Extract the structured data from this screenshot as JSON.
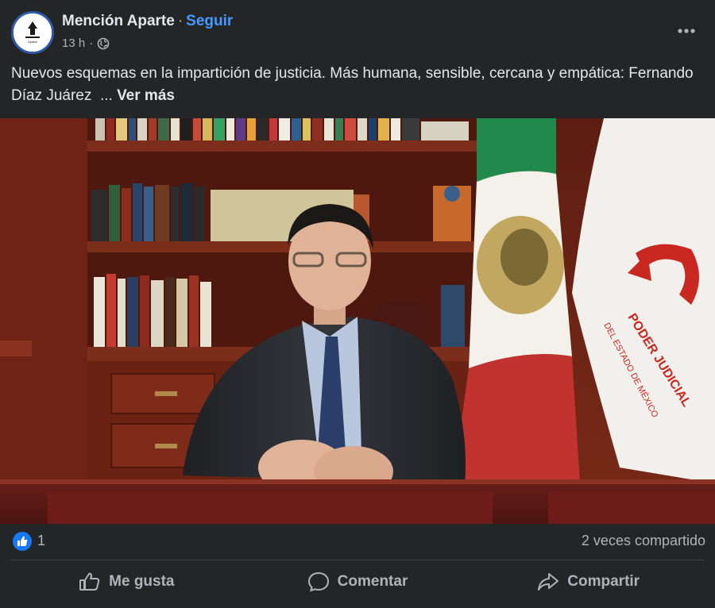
{
  "post": {
    "author": "Mención Aparte",
    "separator": "·",
    "follow_label": "Seguir",
    "time": "13 h",
    "meta_separator": "·",
    "privacy_icon": "globe-icon",
    "avatar_caption": "Aparte",
    "text": "Nuevos esquemas en la impartición de justicia. Más humana, sensible, cercana y empática: Fernando Díaz Juárez",
    "ellipsis": "...",
    "see_more_label": "Ver más"
  },
  "photo": {
    "flag_banner_text": [
      "PODER JUDICIAL",
      "DEL ESTADO DE MÉXICO"
    ],
    "colors": {
      "flag_green": "#1f8a4c",
      "flag_red": "#c0332f",
      "wood": "#7a2a1a",
      "suit": "#2b2d31"
    }
  },
  "reactions": {
    "like_icon": "thumbs-up-icon",
    "like_count": "1",
    "shares_text": "2 veces compartido"
  },
  "actions": [
    {
      "icon": "thumbs-up-outline-icon",
      "label": "Me gusta"
    },
    {
      "icon": "comment-bubble-icon",
      "label": "Comentar"
    },
    {
      "icon": "share-arrow-icon",
      "label": "Compartir"
    }
  ],
  "theme": {
    "background": "#242526",
    "text": "#e4e6eb",
    "secondary": "#b0b3b8",
    "accent": "#4599ff"
  }
}
